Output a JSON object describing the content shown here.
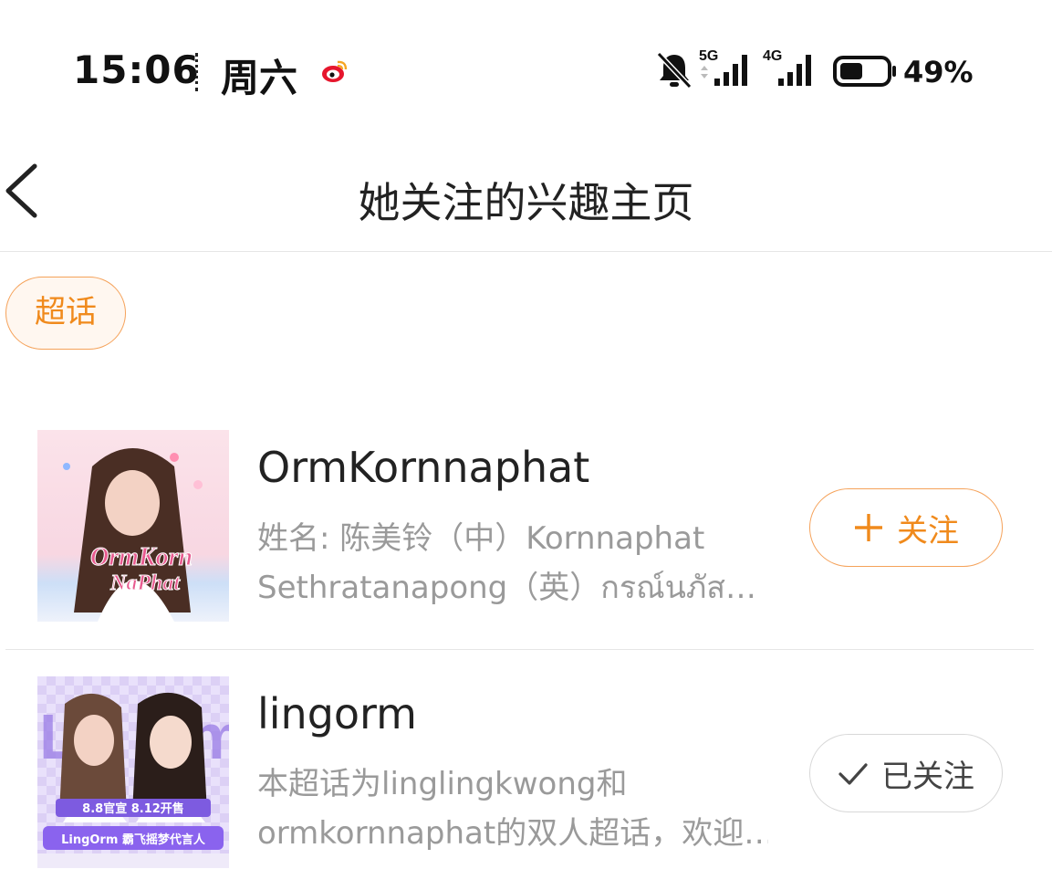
{
  "status_bar": {
    "time": "15:06",
    "day": "周六",
    "battery_percent": "49%",
    "network_1": "5G",
    "network_2": "4G",
    "icons": [
      "weibo-icon",
      "bell-muted-icon",
      "signal-icon",
      "battery-icon"
    ],
    "battery_level": 0.49
  },
  "header": {
    "title": "她关注的兴趣主页",
    "back_icon": "chevron-left-icon"
  },
  "filter": {
    "chip_label": "超话"
  },
  "items": [
    {
      "name": "OrmKornnaphat",
      "desc_line1": "姓名: 陈美铃（中）Kornnaphat",
      "desc_line2": "Sethratanapong（英）กรณ์นภัส…",
      "thumb_text_1": "OrmKorn",
      "thumb_text_2": "NaPhat",
      "button_label": "关注",
      "button_icon": "plus-icon",
      "followed": false
    },
    {
      "name": "lingorm",
      "desc_line1": "本超话为linglingkwong和",
      "desc_line2": "ormkornnaphat的双人超话，欢迎…",
      "thumb_text_1": "8.8官宣 8.12开售",
      "thumb_text_2": "LingOrm 霸飞摇梦代言人",
      "button_label": "已关注",
      "button_icon": "check-icon",
      "followed": true
    }
  ],
  "colors": {
    "accent": "#f08a1c",
    "accent_border": "#f5a25a",
    "chip_bg": "#fff7f0",
    "text_primary": "#222222",
    "text_secondary": "#9a9a9a",
    "divider": "#e6e6e6"
  }
}
